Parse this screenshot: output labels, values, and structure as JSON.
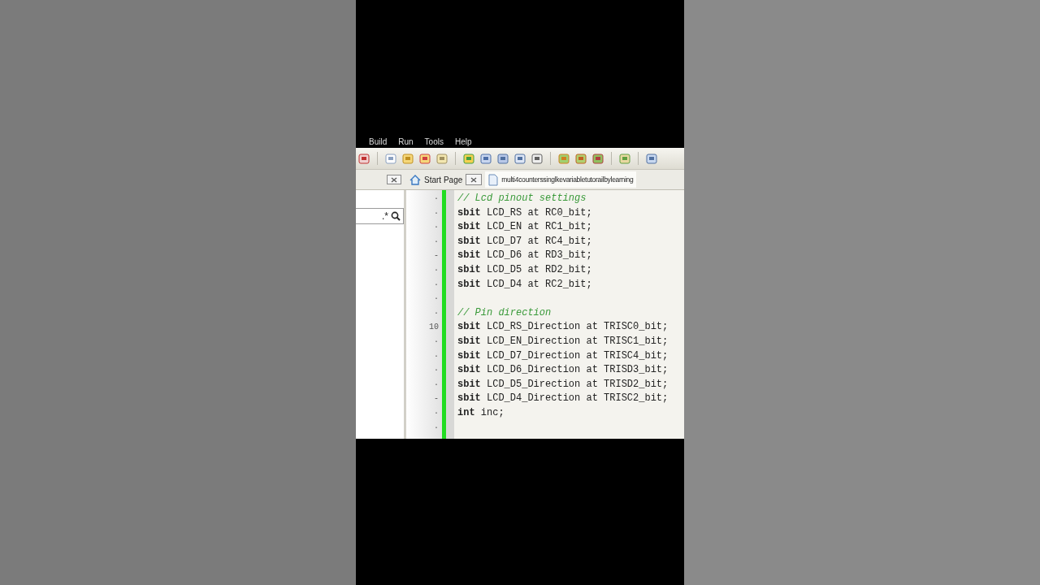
{
  "menu": [
    "Build",
    "Run",
    "Tools",
    "Help"
  ],
  "tabs": [
    {
      "label": "Start Page",
      "kind": "home",
      "selected": false
    },
    {
      "label": "multi4counterssinglkevariabletutorailbylearning",
      "kind": "file",
      "selected": true
    }
  ],
  "search": {
    "value": ".*"
  },
  "lines": [
    {
      "gutter": "·",
      "kind": "comment",
      "text": "// Lcd pinout settings"
    },
    {
      "gutter": "·",
      "kind": "code",
      "text": "**sbit** LCD_RS at RC0_bit;"
    },
    {
      "gutter": "·",
      "kind": "code",
      "text": "**sbit** LCD_EN at RC1_bit;"
    },
    {
      "gutter": "·",
      "kind": "code",
      "text": "**sbit** LCD_D7 at RC4_bit;"
    },
    {
      "gutter": "-",
      "kind": "code",
      "text": "**sbit** LCD_D6 at RD3_bit;"
    },
    {
      "gutter": "·",
      "kind": "code",
      "text": "**sbit** LCD_D5 at RD2_bit;"
    },
    {
      "gutter": "·",
      "kind": "code",
      "text": "**sbit** LCD_D4 at RC2_bit;"
    },
    {
      "gutter": "·",
      "kind": "blank"
    },
    {
      "gutter": "·",
      "kind": "comment",
      "text": "// Pin direction"
    },
    {
      "gutter": "10",
      "kind": "code",
      "text": "**sbit** LCD_RS_Direction at TRISC0_bit;"
    },
    {
      "gutter": "·",
      "kind": "code",
      "text": "**sbit** LCD_EN_Direction at TRISC1_bit;"
    },
    {
      "gutter": "·",
      "kind": "code",
      "text": "**sbit** LCD_D7_Direction at TRISC4_bit;"
    },
    {
      "gutter": "·",
      "kind": "code",
      "text": "**sbit** LCD_D6_Direction at TRISD3_bit;"
    },
    {
      "gutter": "·",
      "kind": "code",
      "text": "**sbit** LCD_D5_Direction at TRISD2_bit;"
    },
    {
      "gutter": "-",
      "kind": "code",
      "text": "**sbit** LCD_D4_Direction at TRISC2_bit;"
    },
    {
      "gutter": "·",
      "kind": "code",
      "text": "**int** inc;"
    },
    {
      "gutter": "·",
      "kind": "blank"
    }
  ]
}
